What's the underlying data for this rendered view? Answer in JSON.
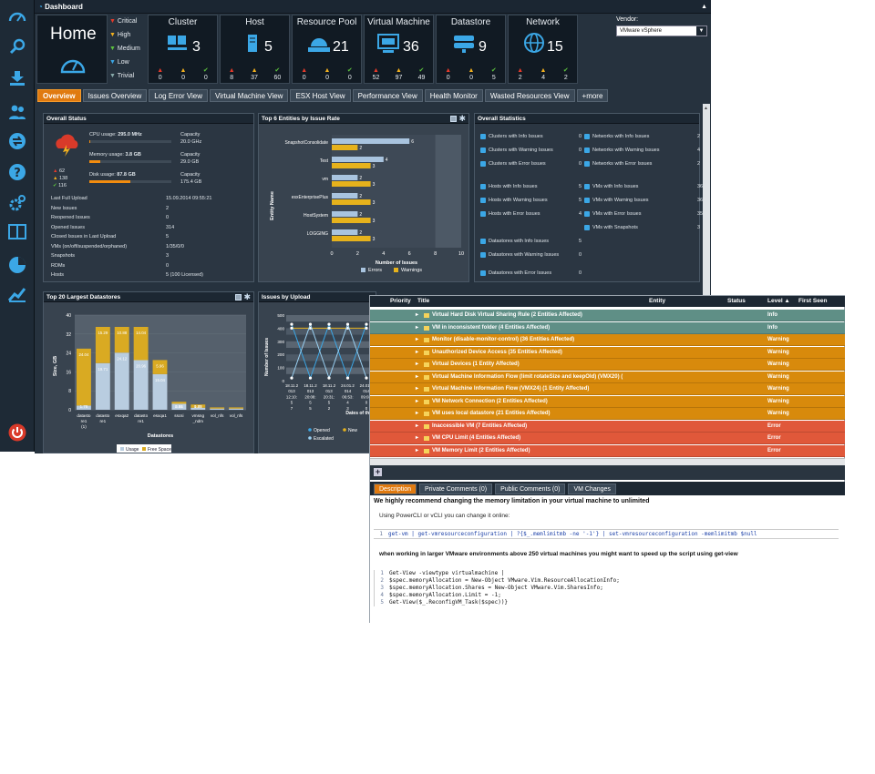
{
  "sidebar": {
    "icons": [
      "dashboard-icon",
      "search-icon",
      "download-icon",
      "users-icon",
      "network-share-icon",
      "help-icon",
      "settings-icon",
      "book-icon",
      "pie-chart-icon",
      "line-chart-icon",
      "power-icon"
    ]
  },
  "header": {
    "title": "Dashboard"
  },
  "home": {
    "label": "Home"
  },
  "legend": {
    "critical": "Critical",
    "high": "High",
    "medium": "Medium",
    "low": "Low",
    "trivial": "Trivial"
  },
  "cards": [
    {
      "title": "Cluster",
      "count": "3",
      "c": [
        "0",
        "0",
        "0"
      ]
    },
    {
      "title": "Host",
      "count": "5",
      "c": [
        "8",
        "37",
        "60"
      ]
    },
    {
      "title": "Resource Pool",
      "count": "21",
      "c": [
        "0",
        "0",
        "0"
      ]
    },
    {
      "title": "Virtual Machine",
      "count": "36",
      "c": [
        "52",
        "97",
        "49"
      ]
    },
    {
      "title": "Datastore",
      "count": "9",
      "c": [
        "0",
        "0",
        "5"
      ]
    },
    {
      "title": "Network",
      "count": "15",
      "c": [
        "2",
        "4",
        "2"
      ]
    }
  ],
  "vendor": {
    "label": "Vendor:",
    "value": "VMware vSphere"
  },
  "tabs": [
    "Overview",
    "Issues Overview",
    "Log Error View",
    "Virtual Machine View",
    "ESX Host View",
    "Performance View",
    "Health Monitor",
    "Wasted Resources View",
    "+more"
  ],
  "overall_status": {
    "title": "Overall Status",
    "cpu_label": "CPU usage: ",
    "cpu_value": "295.0 MHz",
    "cpu_cap": "Capacity",
    "cpu_cap_val": "20.0 GHz",
    "cpu_frac": 0.015,
    "mem_label": "Memory usage: ",
    "mem_value": "3.8 GB",
    "mem_cap": "Capacity",
    "mem_cap_val": "29.0 GB",
    "mem_frac": 0.13,
    "disk_label": "Disk usage: ",
    "disk_value": "87.8 GB",
    "disk_cap": "Capacity",
    "disk_cap_val": "175.4 GB",
    "disk_frac": 0.5,
    "counts": [
      "62",
      "138",
      "116"
    ],
    "rows": [
      [
        "Last Full Upload",
        "15.09.2014 09:55:21"
      ],
      [
        "New Issues",
        "2"
      ],
      [
        "Reopened Issues",
        "0"
      ],
      [
        "Opened Issues",
        "314"
      ],
      [
        "Closed Issues in Last Upload",
        "5"
      ],
      [
        "VMs (on/off/suspended/orphaned)",
        "1/35/0/0"
      ],
      [
        "Snapshots",
        "3"
      ],
      [
        "RDMs",
        "0"
      ],
      [
        "Hosts",
        "5 (100 Licensed)"
      ]
    ]
  },
  "top6": {
    "title": "Top 6 Entities by Issue Rate",
    "ylabel": "Entity Name",
    "xlabel": "Number of Issues",
    "legend": [
      "Errors",
      "Warnings"
    ]
  },
  "overall_stats": {
    "title": "Overall Statistics",
    "left": [
      [
        "Clusters with Info Issues",
        "0"
      ],
      [
        "Clusters with Warning Issues",
        "0"
      ],
      [
        "Clusters with Error Issues",
        "0"
      ],
      [
        "Hosts with Info Issues",
        "5"
      ],
      [
        "Hosts with Warning Issues",
        "5"
      ],
      [
        "Hosts with Error Issues",
        "4"
      ],
      [
        "Datastores with Info Issues",
        "5"
      ],
      [
        "Datastores with Warning Issues",
        "0"
      ],
      [
        "Datastores with Error Issues",
        "0"
      ]
    ],
    "right": [
      [
        "Networks with Info Issues",
        "2"
      ],
      [
        "Networks with Warning Issues",
        "4"
      ],
      [
        "Networks with Error Issues",
        "2"
      ],
      [
        "VMs with Info Issues",
        "36"
      ],
      [
        "VMs with Warning Issues",
        "36"
      ],
      [
        "VMs with Error Issues",
        "35"
      ],
      [
        "VMs with Snapshots",
        "3"
      ]
    ]
  },
  "top20": {
    "title": "Top 20 Largest Datastores",
    "ylabel": "Size, GB",
    "xlabel": "Datastores",
    "legend": [
      "Usage",
      "Free Space"
    ]
  },
  "uploads": {
    "title": "Issues by Upload",
    "ylabel": "Number of Issues",
    "xlabel": "Dates of the",
    "legend": [
      "Opened",
      "New",
      "Escalated"
    ],
    "dates": [
      "18.11.2\n013\n12:10:\n5\n7",
      "18.11.2\n013\n20:08:\n5\n5",
      "18.11.2\n013\n20:31:\n5\n2",
      "24.01.2\n014\n06:53:\n4\n3",
      "24.01.2\n014\n09:03:\n0\n0"
    ]
  },
  "issues": {
    "cols": [
      "Priority",
      "Title",
      "Entity",
      "Status",
      "Level ▲",
      "First Seen"
    ],
    "rows": [
      {
        "title": "Virtual Hard Disk Virtual Sharing Rule (2 Entities Affected)",
        "level": "Info",
        "color": "#5f8f86"
      },
      {
        "title": "VM in inconsistent folder (4 Entities Affected)",
        "level": "Info",
        "color": "#5f8f86"
      },
      {
        "title": "Monitor (disable-monitor-control) (36 Entities Affected)",
        "level": "Warning",
        "color": "#d88a0c"
      },
      {
        "title": "Unauthorized Device Access (35 Entities Affected)",
        "level": "Warning",
        "color": "#d88a0c"
      },
      {
        "title": "Virtual Devices (1 Entity Affected)",
        "level": "Warning",
        "color": "#d88a0c"
      },
      {
        "title": "Virtual Machine Information Flow (limit rotateSize and keepOld) (VMX20) (",
        "level": "Warning",
        "color": "#d88a0c"
      },
      {
        "title": "Virtual Machine Information Flow (VMX24) (1 Entity Affected)",
        "level": "Warning",
        "color": "#d88a0c"
      },
      {
        "title": "VM Network Connection (2 Entities Affected)",
        "level": "Warning",
        "color": "#d88a0c"
      },
      {
        "title": "VM uses local datastore (21 Entities Affected)",
        "level": "Warning",
        "color": "#d88a0c"
      },
      {
        "title": "Inaccessible VM (7 Entities Affected)",
        "level": "Error",
        "color": "#e0583a"
      },
      {
        "title": "VM CPU Limit (4 Entities Affected)",
        "level": "Error",
        "color": "#e0583a"
      },
      {
        "title": "VM Memory Limit (2 Entities Affected)",
        "level": "Error",
        "color": "#e0583a"
      }
    ]
  },
  "detail": {
    "tabs": [
      "Description",
      "Private Comments (0)",
      "Public Comments (0)",
      "VM Changes"
    ],
    "heading": "We highly recommend changing the memory limitation in your virtual machine to unlimited",
    "intro": "Using PowerCLI or vCLI you can change it online:",
    "line1": "get-vm | get-vmresourceconfiguration | ?{$_.memlimitmb -ne '-1'} | set-vmresourceconfiguration -memlimitmb $null",
    "heading2": "when working in larger VMware environments above 250 virtual machines you might want to speed up the script using get-view",
    "code": [
      "Get-View -viewtype virtualmachine |",
      "$spec.memoryAllocation = New-Object VMware.Vim.ResourceAllocationInfo;",
      "$spec.memoryAllocation.Shares = New-Object VMware.Vim.SharesInfo;",
      "$spec.memoryAllocation.Limit = -1;",
      "Get-View($_.ReconfigVM_Task($spec))}"
    ]
  },
  "chart_data": [
    {
      "type": "bar",
      "title": "Top 6 Entities by Issue Rate",
      "xlabel": "Number of Issues",
      "ylabel": "Entity Name",
      "categories": [
        "SnapshotConsolidate",
        "Test",
        "vm",
        "esxEnterprisePlus",
        "HostSystem",
        "LOGGING"
      ],
      "series": [
        {
          "name": "Errors",
          "values": [
            6,
            4,
            2,
            2,
            2,
            2
          ]
        },
        {
          "name": "Warnings",
          "values": [
            2,
            3,
            3,
            3,
            3,
            3
          ]
        }
      ],
      "xlim": [
        0,
        10
      ],
      "xticks": [
        "0",
        "2",
        "4",
        "6",
        "8",
        "10"
      ]
    },
    {
      "type": "bar",
      "title": "Top 20 Largest Datastores",
      "xlabel": "Datastores",
      "ylabel": "Size, GB",
      "categories": [
        "datasto re1 (1)",
        "datasto re1",
        "esxqa2",
        "datasto re1",
        "esxqa1",
        "sscsi",
        "vmsng _ndm",
        "vol_nfs",
        "vol_nfs"
      ],
      "series": [
        {
          "name": "Usage",
          "values": [
            1.78,
            19.71,
            24.12,
            20.96,
            15.04,
            2.51,
            0.87,
            0.5,
            0.5
          ]
        },
        {
          "name": "Free Space",
          "values": [
            24.04,
            15.29,
            10.88,
            14.04,
            5.96,
            0.86,
            1.35,
            0.5,
            0.5
          ]
        }
      ],
      "ylim": [
        0,
        40
      ],
      "yticks": [
        "0",
        "8",
        "16",
        "24",
        "32",
        "40"
      ],
      "labels": [
        "24.04",
        "15.29",
        "10.88",
        "14.04",
        "5.96",
        "0.86",
        "1.35",
        "1.78",
        "19.71",
        "24.12",
        "20.96",
        "15.04",
        "2.51",
        "0.87"
      ]
    },
    {
      "type": "line",
      "title": "Issues by Upload",
      "xlabel": "Dates of the",
      "ylabel": "Number of Issues",
      "yticks": [
        "0",
        "100",
        "200",
        "300",
        "400",
        "500"
      ],
      "ylim": [
        0,
        500
      ],
      "series": [
        {
          "name": "Opened",
          "values": [
            430,
            20,
            430,
            20,
            430
          ]
        },
        {
          "name": "New",
          "values": [
            400,
            400,
            400,
            400,
            400
          ]
        },
        {
          "name": "Escalated",
          "values": [
            20,
            430,
            20,
            430,
            20
          ]
        }
      ]
    }
  ]
}
